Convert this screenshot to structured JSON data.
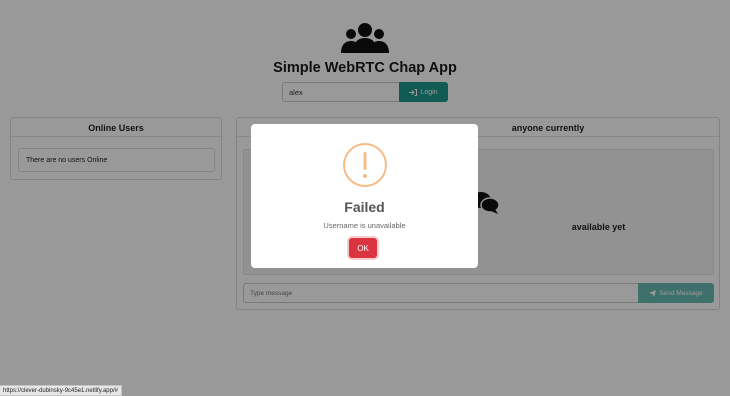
{
  "app": {
    "title": "Simple WebRTC Chap App",
    "logo_icon": "users-group-icon"
  },
  "login": {
    "username_value": "alex",
    "button_label": "Login",
    "button_icon": "sign-in-icon"
  },
  "online_users": {
    "heading": "Online Users",
    "empty_text": "There are no users Online"
  },
  "chat": {
    "heading_visible": "anyone currently",
    "empty_icon": "comments-icon",
    "empty_text_visible": "available yet",
    "message_placeholder": "Type message",
    "send_label": "Send Message",
    "send_icon": "paper-plane-icon"
  },
  "modal": {
    "icon": "warning-icon",
    "title": "Failed",
    "message": "Username is unavailable",
    "ok_label": "OK"
  },
  "status_bar": {
    "url": "https://clever-dubinsky-9c45e1.netlify.app/#"
  },
  "colors": {
    "accent": "#1c9a8d",
    "danger": "#d9343f",
    "warning": "#f8bb86"
  }
}
